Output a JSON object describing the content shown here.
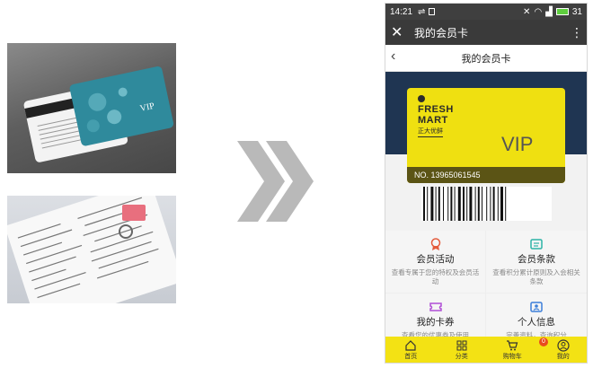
{
  "status_bar": {
    "time": "14:21",
    "battery": "31"
  },
  "title_bar": {
    "title": "我的会员卡",
    "close_glyph": "✕",
    "more_glyph": "⋮"
  },
  "nav_bar": {
    "title": "我的会员卡",
    "back_glyph": "‹"
  },
  "card": {
    "brand_line1": "FRESH",
    "brand_line2": "MART",
    "brand_sub": "正大优鲜",
    "tier": "VIP",
    "number": "NO. 13965061545",
    "color": "#efe011",
    "band_color": "#1f3552"
  },
  "menu": [
    {
      "title": "会员活动",
      "desc": "查看专属于您的特权及会员活动",
      "icon": "award-icon",
      "color": "#e45b3c"
    },
    {
      "title": "会员条款",
      "desc": "查看积分累计原则及入会相关条款",
      "icon": "document-icon",
      "color": "#2db3a6"
    },
    {
      "title": "我的卡券",
      "desc": "查看您的优惠券及使用",
      "icon": "ticket-icon",
      "color": "#b04fd6"
    },
    {
      "title": "个人信息",
      "desc": "完善资料，查询积分",
      "icon": "id-card-icon",
      "color": "#3d7fd9"
    }
  ],
  "tab_bar": {
    "items": [
      "首页",
      "分类",
      "购物车",
      "我的"
    ],
    "cart_count": "0",
    "color": "#f3e214"
  }
}
